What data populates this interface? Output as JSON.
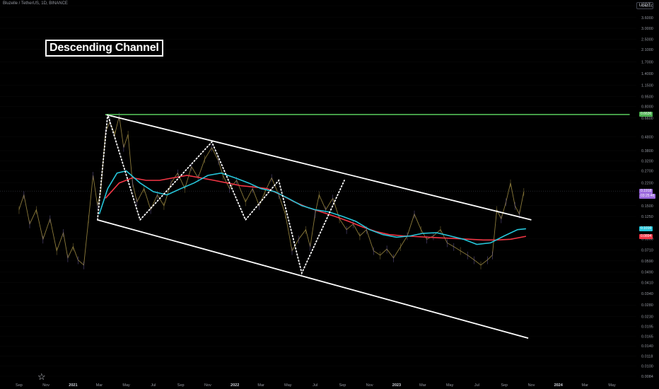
{
  "header": {
    "pair": "Bluzelle / TetherUS, 1D, BINANCE",
    "currency": "USDT"
  },
  "annotation": {
    "title": "Descending Channel"
  },
  "logo_icon": "tradingview-logo-icon",
  "chart_data": {
    "type": "line",
    "scale": "log",
    "ylim": [
      0.0084,
      4.4
    ],
    "y_ticks": [
      "4.4000",
      "3.6000",
      "3.0000",
      "2.5000",
      "2.1000",
      "1.7000",
      "1.4000",
      "1.1500",
      "0.9500",
      "0.8000",
      "0.6600",
      "0.4800",
      "0.3800",
      "0.3200",
      "0.2700",
      "0.2200",
      "0.1500",
      "0.1250",
      "0.0860",
      "0.0710",
      "0.0590",
      "0.0490",
      "0.0410",
      "0.0340",
      "0.0280",
      "0.0230",
      "0.0195",
      "0.0165",
      "0.0140",
      "0.0118",
      "0.0100",
      "0.0084"
    ],
    "y_tick_values": [
      4.4,
      3.6,
      3.0,
      2.5,
      2.1,
      1.7,
      1.4,
      1.15,
      0.95,
      0.8,
      0.66,
      0.48,
      0.38,
      0.32,
      0.27,
      0.22,
      0.15,
      0.125,
      0.086,
      0.071,
      0.059,
      0.049,
      0.041,
      0.034,
      0.028,
      0.023,
      0.0195,
      0.0165,
      0.014,
      0.0118,
      0.01,
      0.0084
    ],
    "x_labels": [
      "Sep",
      "Nov",
      "2021",
      "Mar",
      "May",
      "Jul",
      "Sep",
      "Nov",
      "2022",
      "Mar",
      "May",
      "Jul",
      "Sep",
      "Nov",
      "2023",
      "Mar",
      "May",
      "Jul",
      "Sep",
      "Nov",
      "2024",
      "Mar",
      "May"
    ],
    "x_dates": [
      "2020-09-01",
      "2020-11-01",
      "2021-01-01",
      "2021-03-01",
      "2021-05-01",
      "2021-07-01",
      "2021-09-01",
      "2021-11-01",
      "2022-01-01",
      "2022-03-01",
      "2022-05-01",
      "2022-07-01",
      "2022-09-01",
      "2022-11-01",
      "2023-01-01",
      "2023-03-01",
      "2023-05-01",
      "2023-07-01",
      "2023-09-01",
      "2023-11-01",
      "2024-01-01",
      "2024-03-01",
      "2024-05-01"
    ],
    "price_labels": [
      {
        "value": 0.7,
        "text": "0.6636",
        "color": "#4caf50"
      },
      {
        "value": 0.1918,
        "text": "0.1918",
        "color": "#9c6ade"
      },
      {
        "value": 0.1918,
        "text": "03:25:46",
        "color": "#9c6ade"
      },
      {
        "value": 0.1016,
        "text": "0.1016",
        "color": "#26c6da"
      },
      {
        "value": 0.0894,
        "text": "0.0894",
        "color": "#f23645"
      }
    ],
    "price_series": {
      "name": "",
      "color": "#8b7a3a",
      "points": [
        [
          "2020-09-01",
          0.14
        ],
        [
          "2020-09-12",
          0.18
        ],
        [
          "2020-09-25",
          0.11
        ],
        [
          "2020-10-10",
          0.14
        ],
        [
          "2020-10-25",
          0.085
        ],
        [
          "2020-11-10",
          0.12
        ],
        [
          "2020-11-25",
          0.07
        ],
        [
          "2020-12-10",
          0.095
        ],
        [
          "2020-12-20",
          0.062
        ],
        [
          "2021-01-01",
          0.075
        ],
        [
          "2021-01-12",
          0.06
        ],
        [
          "2021-01-25",
          0.055
        ],
        [
          "2021-02-05",
          0.12
        ],
        [
          "2021-02-15",
          0.25
        ],
        [
          "2021-02-25",
          0.15
        ],
        [
          "2021-03-05",
          0.2
        ],
        [
          "2021-03-15",
          0.52
        ],
        [
          "2021-03-25",
          0.62
        ],
        [
          "2021-04-05",
          0.5
        ],
        [
          "2021-04-15",
          0.68
        ],
        [
          "2021-04-25",
          0.4
        ],
        [
          "2021-05-05",
          0.5
        ],
        [
          "2021-05-15",
          0.22
        ],
        [
          "2021-05-25",
          0.16
        ],
        [
          "2021-06-10",
          0.2
        ],
        [
          "2021-06-25",
          0.14
        ],
        [
          "2021-07-10",
          0.18
        ],
        [
          "2021-07-25",
          0.15
        ],
        [
          "2021-08-10",
          0.22
        ],
        [
          "2021-08-25",
          0.26
        ],
        [
          "2021-09-10",
          0.2
        ],
        [
          "2021-09-25",
          0.29
        ],
        [
          "2021-10-10",
          0.24
        ],
        [
          "2021-10-25",
          0.33
        ],
        [
          "2021-11-10",
          0.4
        ],
        [
          "2021-11-25",
          0.32
        ],
        [
          "2021-12-05",
          0.25
        ],
        [
          "2021-12-20",
          0.2
        ],
        [
          "2022-01-05",
          0.23
        ],
        [
          "2022-01-25",
          0.16
        ],
        [
          "2022-02-10",
          0.2
        ],
        [
          "2022-02-25",
          0.15
        ],
        [
          "2022-03-10",
          0.19
        ],
        [
          "2022-03-25",
          0.24
        ],
        [
          "2022-04-10",
          0.18
        ],
        [
          "2022-04-25",
          0.13
        ],
        [
          "2022-05-10",
          0.07
        ],
        [
          "2022-05-25",
          0.085
        ],
        [
          "2022-06-10",
          0.1
        ],
        [
          "2022-06-20",
          0.075
        ],
        [
          "2022-07-01",
          0.13
        ],
        [
          "2022-07-10",
          0.18
        ],
        [
          "2022-07-25",
          0.14
        ],
        [
          "2022-08-10",
          0.17
        ],
        [
          "2022-08-25",
          0.12
        ],
        [
          "2022-09-10",
          0.1
        ],
        [
          "2022-09-25",
          0.11
        ],
        [
          "2022-10-10",
          0.09
        ],
        [
          "2022-10-25",
          0.1
        ],
        [
          "2022-11-10",
          0.07
        ],
        [
          "2022-11-25",
          0.065
        ],
        [
          "2022-12-10",
          0.072
        ],
        [
          "2022-12-25",
          0.062
        ],
        [
          "2023-01-10",
          0.075
        ],
        [
          "2023-01-25",
          0.09
        ],
        [
          "2023-02-10",
          0.13
        ],
        [
          "2023-02-25",
          0.1
        ],
        [
          "2023-03-10",
          0.085
        ],
        [
          "2023-03-25",
          0.09
        ],
        [
          "2023-04-10",
          0.1
        ],
        [
          "2023-04-25",
          0.08
        ],
        [
          "2023-05-10",
          0.075
        ],
        [
          "2023-05-25",
          0.07
        ],
        [
          "2023-06-10",
          0.065
        ],
        [
          "2023-06-25",
          0.06
        ],
        [
          "2023-07-10",
          0.055
        ],
        [
          "2023-07-25",
          0.06
        ],
        [
          "2023-08-05",
          0.065
        ],
        [
          "2023-08-15",
          0.14
        ],
        [
          "2023-08-25",
          0.12
        ],
        [
          "2023-09-05",
          0.16
        ],
        [
          "2023-09-15",
          0.22
        ],
        [
          "2023-09-25",
          0.15
        ],
        [
          "2023-10-05",
          0.13
        ],
        [
          "2023-10-15",
          0.19
        ]
      ]
    },
    "ma_fast": {
      "name": "",
      "color": "#26c6da",
      "points": [
        [
          "2021-03-01",
          0.13
        ],
        [
          "2021-03-20",
          0.2
        ],
        [
          "2021-04-10",
          0.26
        ],
        [
          "2021-05-01",
          0.27
        ],
        [
          "2021-06-01",
          0.22
        ],
        [
          "2021-07-01",
          0.19
        ],
        [
          "2021-08-01",
          0.18
        ],
        [
          "2021-09-01",
          0.2
        ],
        [
          "2021-10-01",
          0.22
        ],
        [
          "2021-11-01",
          0.25
        ],
        [
          "2021-12-01",
          0.26
        ],
        [
          "2022-01-01",
          0.24
        ],
        [
          "2022-02-01",
          0.22
        ],
        [
          "2022-03-01",
          0.2
        ],
        [
          "2022-04-01",
          0.19
        ],
        [
          "2022-05-01",
          0.17
        ],
        [
          "2022-06-01",
          0.15
        ],
        [
          "2022-07-01",
          0.14
        ],
        [
          "2022-08-01",
          0.135
        ],
        [
          "2022-09-01",
          0.125
        ],
        [
          "2022-10-01",
          0.115
        ],
        [
          "2022-11-01",
          0.1
        ],
        [
          "2022-12-01",
          0.092
        ],
        [
          "2023-01-01",
          0.088
        ],
        [
          "2023-02-01",
          0.09
        ],
        [
          "2023-03-01",
          0.094
        ],
        [
          "2023-04-01",
          0.095
        ],
        [
          "2023-05-01",
          0.09
        ],
        [
          "2023-06-01",
          0.085
        ],
        [
          "2023-07-01",
          0.078
        ],
        [
          "2023-08-01",
          0.08
        ],
        [
          "2023-09-01",
          0.09
        ],
        [
          "2023-10-01",
          0.1
        ],
        [
          "2023-10-20",
          0.1016
        ]
      ]
    },
    "ma_slow": {
      "name": "",
      "color": "#f23645",
      "points": [
        [
          "2021-03-15",
          0.17
        ],
        [
          "2021-04-15",
          0.22
        ],
        [
          "2021-05-15",
          0.24
        ],
        [
          "2021-06-15",
          0.23
        ],
        [
          "2021-07-15",
          0.23
        ],
        [
          "2021-08-15",
          0.24
        ],
        [
          "2021-09-15",
          0.25
        ],
        [
          "2021-10-15",
          0.24
        ],
        [
          "2021-11-15",
          0.23
        ],
        [
          "2021-12-15",
          0.22
        ],
        [
          "2022-01-15",
          0.21
        ],
        [
          "2022-02-15",
          0.205
        ],
        [
          "2022-03-15",
          0.2
        ],
        [
          "2022-04-15",
          0.18
        ],
        [
          "2022-05-15",
          0.16
        ],
        [
          "2022-06-15",
          0.145
        ],
        [
          "2022-07-15",
          0.135
        ],
        [
          "2022-08-15",
          0.125
        ],
        [
          "2022-09-15",
          0.115
        ],
        [
          "2022-10-15",
          0.105
        ],
        [
          "2022-11-15",
          0.097
        ],
        [
          "2022-12-15",
          0.092
        ],
        [
          "2023-01-15",
          0.09
        ],
        [
          "2023-02-15",
          0.089
        ],
        [
          "2023-03-15",
          0.088
        ],
        [
          "2023-04-15",
          0.087
        ],
        [
          "2023-05-15",
          0.086
        ],
        [
          "2023-06-15",
          0.085
        ],
        [
          "2023-07-15",
          0.084
        ],
        [
          "2023-08-15",
          0.084
        ],
        [
          "2023-09-15",
          0.085
        ],
        [
          "2023-10-20",
          0.0894
        ]
      ]
    },
    "channel_upper": {
      "from": [
        "2021-03-15",
        0.7
      ],
      "to": [
        "2023-11-01",
        0.118
      ]
    },
    "channel_lower": {
      "from": [
        "2021-02-25",
        0.118
      ],
      "to": [
        "2023-10-25",
        0.016
      ]
    },
    "resistance": {
      "value": 0.7,
      "from": "2021-03-15",
      "to": "2024-06-10",
      "color": "#4caf50"
    },
    "wave_path": [
      [
        "2021-02-25",
        0.118
      ],
      [
        "2021-03-20",
        0.7
      ],
      [
        "2021-06-01",
        0.118
      ],
      [
        "2021-11-10",
        0.44
      ],
      [
        "2022-01-25",
        0.118
      ],
      [
        "2022-04-10",
        0.23
      ],
      [
        "2022-06-01",
        0.048
      ],
      [
        "2022-09-05",
        0.23
      ]
    ],
    "current_price_line": 0.1918
  }
}
